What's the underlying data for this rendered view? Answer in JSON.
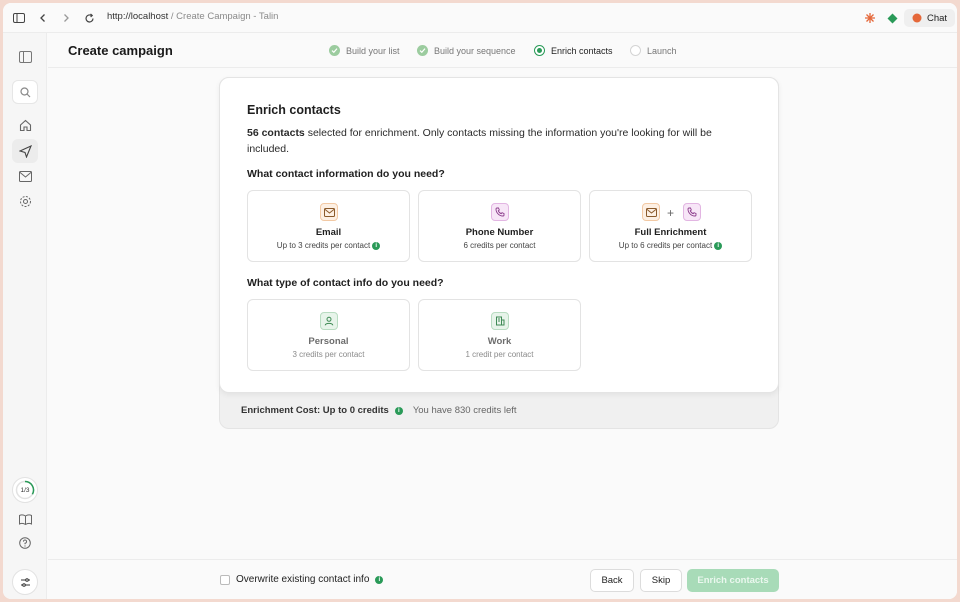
{
  "browser": {
    "url_host": "http://localhost",
    "url_title": " / Create Campaign - Talin",
    "chat_label": "Chat",
    "icons": [
      "sidebar-toggle-icon",
      "back-icon",
      "forward-icon",
      "reload-icon",
      "sparkle-icon",
      "diamond-icon",
      "chat-bubble-icon"
    ]
  },
  "sidebar": {
    "progress_label": "1/3",
    "items": [
      "panel-icon",
      "search-icon",
      "home-icon",
      "send-icon",
      "mail-icon",
      "gear-icon",
      "book-icon",
      "help-icon",
      "settings-sliders-icon"
    ]
  },
  "header": {
    "title": "Create campaign",
    "steps": [
      {
        "label": "Build your list",
        "state": "done"
      },
      {
        "label": "Build your sequence",
        "state": "done"
      },
      {
        "label": "Enrich contacts",
        "state": "current"
      },
      {
        "label": "Launch",
        "state": "todo"
      }
    ]
  },
  "enrich": {
    "title": "Enrich contacts",
    "count_text": "56 contacts",
    "desc_rest": " selected for enrichment. Only contacts missing the information you're looking for will be included.",
    "q1": "What contact information do you need?",
    "options": [
      {
        "name": "Email",
        "sub": "Up to 3 credits per contact",
        "icon": "mail-icon"
      },
      {
        "name": "Phone Number",
        "sub": "6 credits per contact",
        "icon": "phone-icon"
      },
      {
        "name": "Full Enrichment",
        "sub": "Up to 6 credits per contact",
        "icon": "mail-plus-phone-icon",
        "plus": "+"
      }
    ],
    "q2": "What type of contact info do you need?",
    "types": [
      {
        "name": "Personal",
        "sub": "3 credits per contact",
        "icon": "person-icon"
      },
      {
        "name": "Work",
        "sub": "1 credit per contact",
        "icon": "building-icon"
      }
    ],
    "cost_label": "Enrichment Cost: Up to 0 credits",
    "credits_left": "You have 830 credits left"
  },
  "footer": {
    "overwrite_label": "Overwrite existing contact info",
    "back_label": "Back",
    "skip_label": "Skip",
    "enrich_label": "Enrich contacts"
  },
  "colors": {
    "accent": "#2a9a58",
    "primary_disabled": "#a8dbb8",
    "email_icon_bg": "#fdf0e4",
    "phone_icon_bg": "#f7e6f7",
    "type_icon_bg": "#e7f4ea"
  }
}
